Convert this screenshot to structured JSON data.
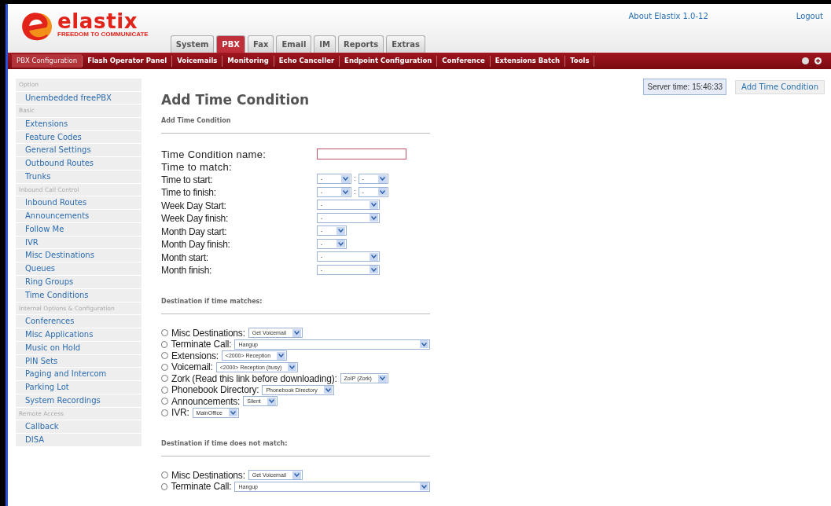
{
  "header": {
    "logo": "elastix",
    "tagline": "FREEDOM TO COMMUNICATE",
    "about": "About Elastix 1.0-12",
    "logout": "Logout"
  },
  "tabs": [
    {
      "label": "System",
      "selected": false
    },
    {
      "label": "PBX",
      "selected": true
    },
    {
      "label": "Fax",
      "selected": false
    },
    {
      "label": "Email",
      "selected": false
    },
    {
      "label": "IM",
      "selected": false
    },
    {
      "label": "Reports",
      "selected": false
    },
    {
      "label": "Extras",
      "selected": false
    }
  ],
  "menu": [
    {
      "label": "PBX Configuration",
      "selected": true
    },
    {
      "label": "Flash Operator Panel",
      "selected": false
    },
    {
      "label": "Voicemails",
      "selected": false
    },
    {
      "label": "Monitoring",
      "selected": false
    },
    {
      "label": "Echo Canceller",
      "selected": false
    },
    {
      "label": "Endpoint Configuration",
      "selected": false
    },
    {
      "label": "Conference",
      "selected": false
    },
    {
      "label": "Extensions Batch",
      "selected": false
    },
    {
      "label": "Tools",
      "selected": false
    }
  ],
  "sidebar": [
    {
      "kind": "group",
      "label": "Option"
    },
    {
      "kind": "link",
      "label": "Unembedded freePBX"
    },
    {
      "kind": "group",
      "label": "Basic"
    },
    {
      "kind": "link",
      "label": "Extensions"
    },
    {
      "kind": "link",
      "label": "Feature Codes"
    },
    {
      "kind": "link",
      "label": "General Settings"
    },
    {
      "kind": "link",
      "label": "Outbound Routes"
    },
    {
      "kind": "link",
      "label": "Trunks"
    },
    {
      "kind": "group",
      "label": "Inbound Call Control"
    },
    {
      "kind": "link",
      "label": "Inbound Routes"
    },
    {
      "kind": "link",
      "label": "Announcements"
    },
    {
      "kind": "link",
      "label": "Follow Me"
    },
    {
      "kind": "link",
      "label": "IVR"
    },
    {
      "kind": "link",
      "label": "Misc Destinations"
    },
    {
      "kind": "link",
      "label": "Queues"
    },
    {
      "kind": "link",
      "label": "Ring Groups"
    },
    {
      "kind": "link",
      "label": "Time Conditions"
    },
    {
      "kind": "group",
      "label": "Internal Options & Configuration"
    },
    {
      "kind": "link",
      "label": "Conferences"
    },
    {
      "kind": "link",
      "label": "Misc Applications"
    },
    {
      "kind": "link",
      "label": "Music on Hold"
    },
    {
      "kind": "link",
      "label": "PIN Sets"
    },
    {
      "kind": "link",
      "label": "Paging and Intercom"
    },
    {
      "kind": "link",
      "label": "Parking Lot"
    },
    {
      "kind": "link",
      "label": "System Recordings"
    },
    {
      "kind": "group",
      "label": "Remote Access"
    },
    {
      "kind": "link",
      "label": "Callback"
    },
    {
      "kind": "link",
      "label": "DISA"
    }
  ],
  "page": {
    "title": "Add Time Condition",
    "server_time": "Server time: 15:46:33",
    "add_button": "Add Time Condition"
  },
  "form": {
    "section": "Add Time Condition",
    "fields": [
      {
        "kind": "text",
        "label": "Time Condition name:"
      },
      {
        "kind": "heading",
        "label": "Time to match:"
      },
      {
        "kind": "time",
        "label": "Time to start:",
        "selects": [
          "-",
          "-"
        ],
        "separator": ":"
      },
      {
        "kind": "time",
        "label": "Time to finish:",
        "selects": [
          "-",
          "-"
        ],
        "separator": ":"
      },
      {
        "kind": "wide_select",
        "label": "Week Day Start:",
        "selects": [
          "-"
        ]
      },
      {
        "kind": "wide_select",
        "label": "Week Day finish:",
        "selects": [
          "-"
        ]
      },
      {
        "kind": "short_select",
        "label": "Month Day start:",
        "selects": [
          "-"
        ]
      },
      {
        "kind": "short_select",
        "label": "Month Day finish:",
        "selects": [
          "-"
        ]
      },
      {
        "kind": "wide_select",
        "label": "Month start:",
        "selects": [
          "-"
        ]
      },
      {
        "kind": "wide_select",
        "label": "Month finish:",
        "selects": [
          "-"
        ]
      }
    ]
  },
  "destinations": [
    {
      "title": "Destination if time matches:",
      "options": [
        {
          "kind": "compact",
          "label": "Misc Destinations:",
          "value": "Get Voicemail",
          "selected": false
        },
        {
          "kind": "long",
          "label": "Terminate Call:",
          "value": "Hangup",
          "selected": false
        },
        {
          "kind": "compact",
          "label": "Extensions:",
          "value": "<2000> Reception",
          "selected": false
        },
        {
          "kind": "compact",
          "label": "Voicemail:",
          "value": "<2000> Reception (busy)",
          "selected": false
        },
        {
          "kind": "compact",
          "label": "Zork (Read this link before downloading):",
          "value": "ZoIP (Zork)",
          "selected": false
        },
        {
          "kind": "compact",
          "label": "Phonebook Directory:",
          "value": "Phonebook Directory",
          "selected": false
        },
        {
          "kind": "compact",
          "label": "Announcements:",
          "value": "Silent",
          "selected": false
        },
        {
          "kind": "compact",
          "label": "IVR:",
          "value": "MainOffice",
          "selected": false
        }
      ]
    },
    {
      "title": "Destination if time does not match:",
      "options": [
        {
          "kind": "compact",
          "label": "Misc Destinations:",
          "value": "Get Voicemail",
          "selected": false
        },
        {
          "kind": "long",
          "label": "Terminate Call:",
          "value": "Hangup",
          "selected": false
        }
      ]
    }
  ]
}
